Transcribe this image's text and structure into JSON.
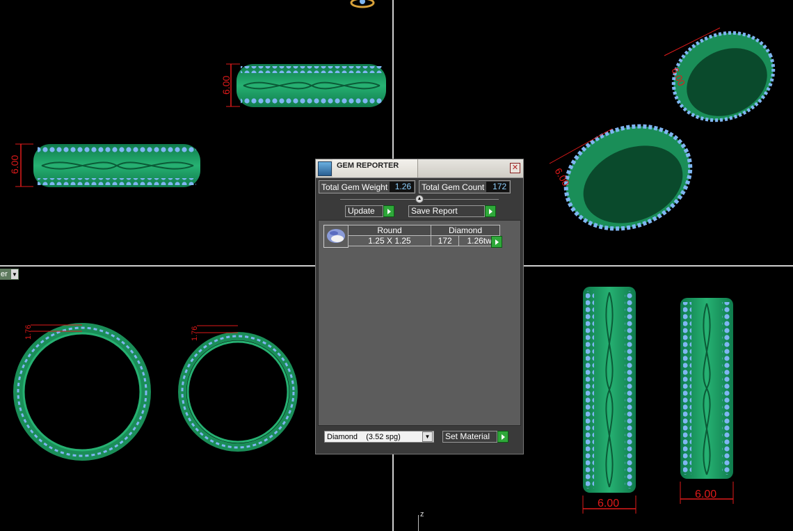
{
  "viewport": {
    "view_menu_label": "er",
    "axis_label": "z",
    "dimensions": {
      "front_height": "6.00",
      "top_height": "6.00",
      "persp_small": "6.00",
      "persp_large": "6.00",
      "side_left_thickness": "1.76",
      "side_right_thickness": "1.76",
      "right_width_a": "6.00",
      "right_width_b": "6.00"
    },
    "colors": {
      "background": "#000000",
      "ring_metal": "#1fa066",
      "ring_dark": "#0e6b43",
      "gems": "#7fb6f2",
      "dimension": "#e01a1a"
    }
  },
  "gem_reporter": {
    "title": "GEM REPORTER",
    "close_label": "✕",
    "total_weight_label": "Total Gem Weight",
    "total_weight_value": "1.26",
    "total_count_label": "Total Gem Count",
    "total_count_value": "172",
    "update_label": "Update",
    "save_report_label": "Save Report",
    "gem_rows": [
      {
        "shape": "Round",
        "material": "Diamond",
        "size": "1.25 X 1.25",
        "count": "172",
        "weight": "1.26tw"
      }
    ],
    "material_select": "Diamond    (3.52 spg)",
    "set_material_label": "Set Material"
  }
}
